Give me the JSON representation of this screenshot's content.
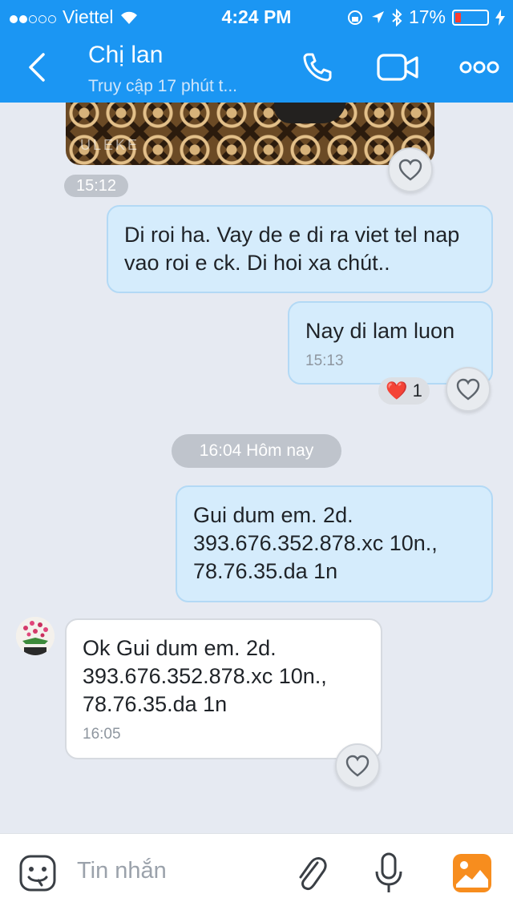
{
  "status_bar": {
    "carrier": "Viettel",
    "time": "4:24 PM",
    "battery": "17%",
    "signal_dots": 5,
    "signal_filled": 2
  },
  "header": {
    "title": "Chị lan",
    "subtitle": "Truy cập 17 phút t..."
  },
  "image_message": {
    "watermark": "ULEKE",
    "time": "15:12"
  },
  "messages": [
    {
      "text": "Di roi ha. Vay de e di ra viet tel nap vao roi e ck. Di hoi xa chút..",
      "direction": "out"
    },
    {
      "text": "Nay di lam luon",
      "time": "15:13",
      "direction": "out",
      "reaction": {
        "emoji": "❤️",
        "count": "1"
      }
    },
    {
      "text": "Gui dum em. 2d. 393.676.352.878.xc 10n., 78.76.35.da 1n",
      "direction": "out"
    },
    {
      "text": "Ok Gui dum em. 2d. 393.676.352.878.xc 10n., 78.76.35.da 1n",
      "time": "16:05",
      "direction": "in"
    }
  ],
  "date_separator": "16:04 Hôm nay",
  "input": {
    "placeholder": "Tin nhắn"
  },
  "colors": {
    "header": "#1b96f3",
    "outgoing_bubble": "#d5ecfc",
    "incoming_bubble": "#ffffff",
    "chat_bg": "#e6eaf2",
    "photo_button": "#f78d1e"
  }
}
